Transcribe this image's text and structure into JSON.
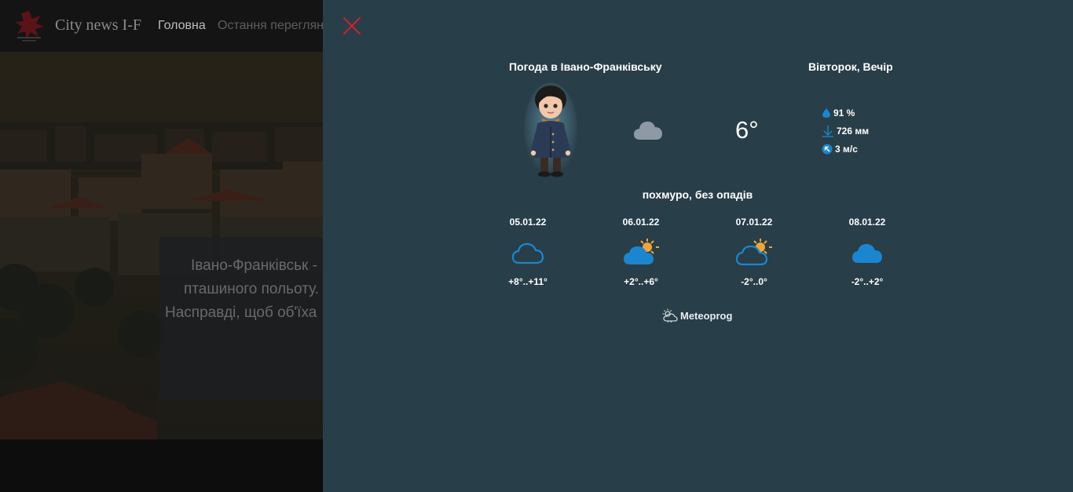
{
  "site": {
    "brand": "City news I-F",
    "nav": {
      "home": "Головна",
      "recent": "Остання переглянт"
    },
    "hero_text": [
      "Івано-Франківськ -",
      "пташиного польоту. А",
      "Насправді, щоб об'їха"
    ]
  },
  "weather": {
    "title": "Погода в Івано-Франківську",
    "period": "Вівторок, Вечір",
    "temperature": "6°",
    "humidity": "91 %",
    "pressure": "726 мм",
    "wind": "3 м/с",
    "description": "похмуро, без опадів",
    "current_icon": "cloud-icon",
    "forecast": [
      {
        "date": "05.01.22",
        "range": "+8°..+11°",
        "icon": "cloud-outline-icon"
      },
      {
        "date": "06.01.22",
        "range": "+2°..+6°",
        "icon": "partly-cloudy-icon"
      },
      {
        "date": "07.01.22",
        "range": "-2°..0°",
        "icon": "partly-cloudy-outline-icon"
      },
      {
        "date": "08.01.22",
        "range": "-2°..+2°",
        "icon": "cloud-icon"
      }
    ],
    "provider": "Meteoprog",
    "colors": {
      "panel_bg": "#283e48",
      "close": "#d3202b",
      "cloud_blue": "#1a86d0",
      "sun": "#f3a537"
    }
  }
}
